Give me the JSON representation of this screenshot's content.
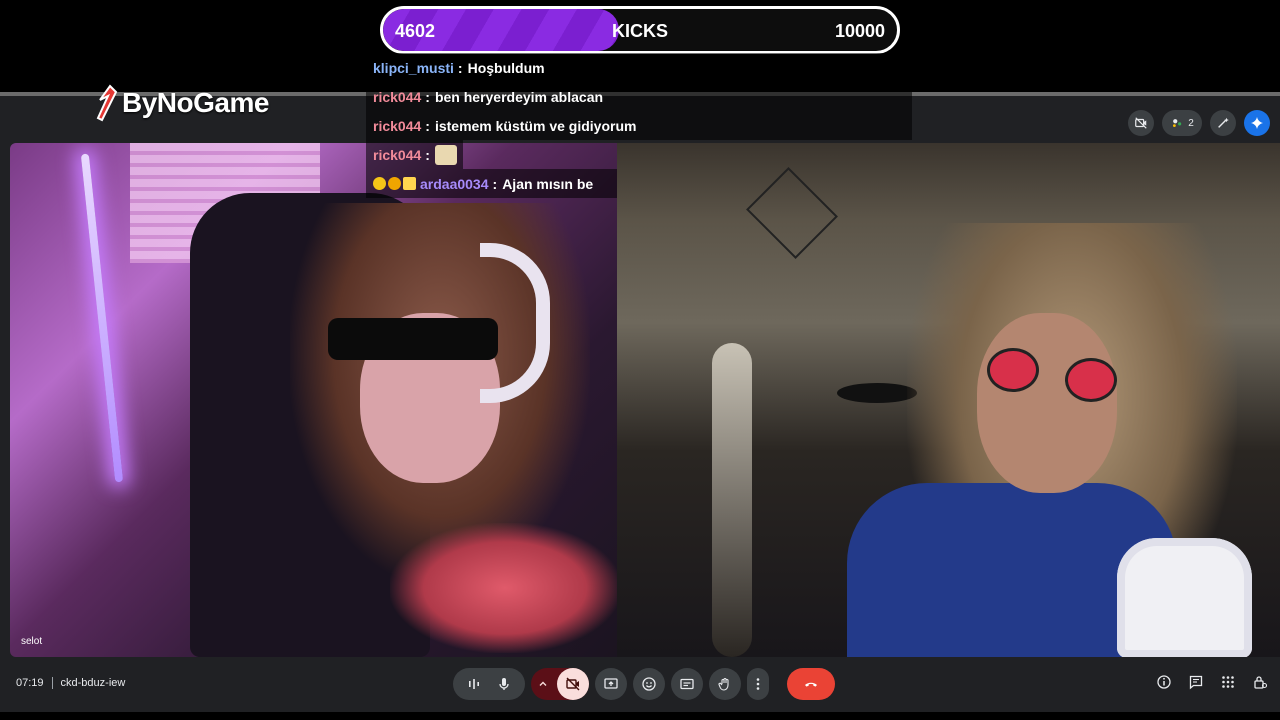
{
  "kicks_bar": {
    "current": "4602",
    "label": "KICKS",
    "goal": "10000",
    "progress_percent": 46,
    "fill_color": "#8a2be2"
  },
  "logo": {
    "text": "ByNoGame",
    "icon": "pen-nib-logo-icon",
    "accent": "#e53935"
  },
  "chat": [
    {
      "user": "klipci_musti",
      "user_color": "#8ab4f8",
      "message": "Hoşbuldum"
    },
    {
      "user": "rick044",
      "user_color": "#f28b9a",
      "message": "ben heryerdeyim ablacan"
    },
    {
      "user": "rick044",
      "user_color": "#f28b9a",
      "message": "istemem küstüm ve gidiyorum"
    },
    {
      "user": "rick044",
      "user_color": "#f28b9a",
      "message": "",
      "emote": "sticker-emote"
    },
    {
      "user": "ardaa0034",
      "user_color": "#a78bfa",
      "message": "Ajan mısın be",
      "badges": [
        "smiley-badge",
        "number-one-badge",
        "crown-badge"
      ]
    }
  ],
  "participants": {
    "left": {
      "name": "selot"
    },
    "right": {
      "name": ""
    }
  },
  "topbar": {
    "people_count": "2",
    "icons": [
      "camera-off-icon",
      "people-icon",
      "sparkle-pen-icon",
      "gemini-icon"
    ]
  },
  "meeting": {
    "time": "07:19",
    "code": "ckd-bduz-iew"
  },
  "controls": {
    "icons": [
      "audio-level-icon",
      "mic-icon",
      "chevron-up-icon",
      "camera-off-icon",
      "present-icon",
      "emoji-icon",
      "captions-icon",
      "raise-hand-icon",
      "more-vert-icon",
      "end-call-icon"
    ],
    "end_call_color": "#ea4335",
    "camera_off_group_color": "#5b0f17"
  },
  "right_controls": {
    "icons": [
      "info-icon",
      "chat-icon",
      "activities-icon",
      "host-controls-icon"
    ]
  }
}
